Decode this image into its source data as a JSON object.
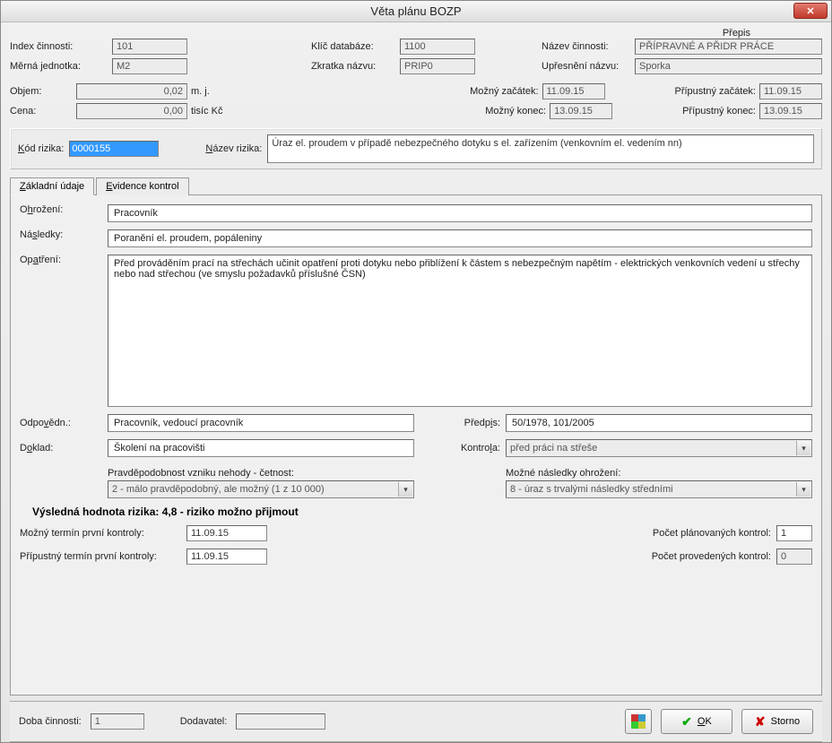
{
  "window": {
    "title": "Věta plánu BOZP",
    "close_x": "✕"
  },
  "header": {
    "prepis_label": "Přepis",
    "index_cinnosti_label": "Index činnosti:",
    "index_cinnosti_value": "101",
    "klic_databaze_label": "Klíč databáze:",
    "klic_databaze_value": "1100",
    "nazev_cinnosti_label": "Název činnosti:",
    "nazev_cinnosti_value": "PŘÍPRAVNÉ A PŘIDR PRÁCE",
    "merna_jednotka_label": "Měrná jednotka:",
    "merna_jednotka_value": "M2",
    "zkratka_nazvu_label": "Zkratka názvu:",
    "zkratka_nazvu_value": "PRIP0",
    "upresneni_nazvu_label": "Upřesnění názvu:",
    "upresneni_nazvu_value": "Sporka",
    "objem_label": "Objem:",
    "objem_value": "0,02",
    "objem_unit": "m. j.",
    "cena_label": "Cena:",
    "cena_value": "0,00",
    "cena_unit": "tisíc Kč",
    "mozny_zacatek_label": "Možný začátek:",
    "mozny_zacatek_value": "11.09.15",
    "mozny_konec_label": "Možný konec:",
    "mozny_konec_value": "13.09.15",
    "pripustny_zacatek_label": "Přípustný začátek:",
    "pripustny_zacatek_value": "11.09.15",
    "pripustny_konec_label": "Přípustný konec:",
    "pripustny_konec_value": "13.09.15"
  },
  "risk": {
    "kod_label": "Kód rizika:",
    "kod_value": "0000155",
    "nazev_label": "Název rizika:",
    "nazev_value": "Úraz el. proudem v případě nebezpečného dotyku s el. zařízením (venkovním el. vedením nn)"
  },
  "tabs": {
    "zakladni": "Základní údaje",
    "evidence": "Evidence kontrol"
  },
  "form": {
    "ohrozeni_label": "Ohrožení:",
    "ohrozeni_value": "Pracovník",
    "nasledky_label": "Následky:",
    "nasledky_value": "Poranění el. proudem, popáleniny",
    "opatreni_label": "Opatření:",
    "opatreni_value": "Před prováděním prací na střechách učinit opatření proti dotyku nebo přiblížení k částem s nebezpečným napětím - elektrických venkovních vedení u střechy nebo nad střechou (ve smyslu požadavků příslušné ČSN)",
    "odpovedn_label": "Odpovědn.:",
    "odpovedn_value": "Pracovník, vedoucí pracovník",
    "predpis_label": "Předpis:",
    "predpis_value": "50/1978, 101/2005",
    "doklad_label": "Doklad:",
    "doklad_value": "Školení na pracovišti",
    "kontrola_label": "Kontrola:",
    "kontrola_value": "před práci na střeše",
    "pravdep_label": "Pravděpodobnost vzniku nehody - četnost:",
    "pravdep_value": "2 - málo pravděpodobný, ale možný (1 z 10 000)",
    "mozne_nasl_label": "Možné následky ohrožení:",
    "mozne_nasl_value": "8 - úraz s trvalými následky středními",
    "vysl_label": "Výsledná hodnota rizika:   4,8 - riziko možno přijmout",
    "mozny_termin_label": "Možný termín první kontroly:",
    "mozny_termin_value": "11.09.15",
    "pripustny_termin_label": "Přípustný termín první kontroly:",
    "pripustny_termin_value": "11.09.15",
    "pocet_plan_label": "Počet plánovaných kontrol:",
    "pocet_plan_value": "1",
    "pocet_prov_label": "Počet provedených kontrol:",
    "pocet_prov_value": "0"
  },
  "footer": {
    "doba_label": "Doba činnosti:",
    "doba_value": "1",
    "dodavatel_label": "Dodavatel:",
    "dodavatel_value": "",
    "ok_label": "OK",
    "storno_label": "Storno"
  }
}
